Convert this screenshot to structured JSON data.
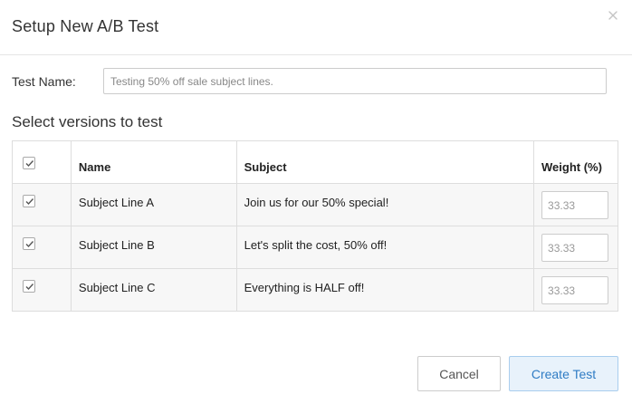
{
  "dialog": {
    "title": "Setup New A/B Test",
    "close_icon": "close-icon"
  },
  "test_name": {
    "label": "Test Name:",
    "value": "Testing 50% off sale subject lines."
  },
  "versions": {
    "section_title": "Select versions to test",
    "columns": {
      "name": "Name",
      "subject": "Subject",
      "weight": "Weight (%)"
    },
    "select_all_checked": true,
    "rows": [
      {
        "checked": true,
        "name": "Subject Line A",
        "subject": "Join us for our 50% special!",
        "weight": "33.33"
      },
      {
        "checked": true,
        "name": "Subject Line B",
        "subject": "Let's split the cost, 50% off!",
        "weight": "33.33"
      },
      {
        "checked": true,
        "name": "Subject Line C",
        "subject": "Everything is HALF off!",
        "weight": "33.33"
      }
    ]
  },
  "actions": {
    "cancel_label": "Cancel",
    "create_label": "Create Test"
  },
  "colors": {
    "primary_text": "#2f7cc4",
    "primary_bg": "#e8f2fb",
    "primary_border": "#a9cdee",
    "border": "#dddddd"
  }
}
